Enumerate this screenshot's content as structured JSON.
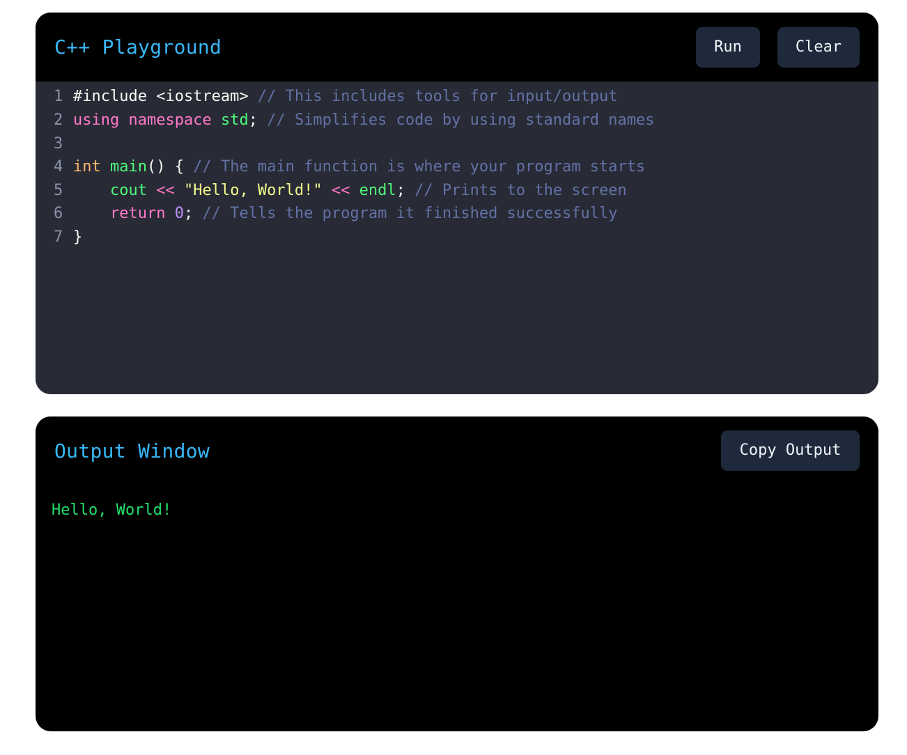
{
  "editor": {
    "title": "C++ Playground",
    "run_label": "Run",
    "clear_label": "Clear",
    "lines": [
      {
        "num": "1",
        "tokens": [
          {
            "text": "#include <iostream> ",
            "cls": "t-plain"
          },
          {
            "text": "// This includes tools for input/output",
            "cls": "t-comment"
          }
        ]
      },
      {
        "num": "2",
        "tokens": [
          {
            "text": "using",
            "cls": "t-kw"
          },
          {
            "text": " ",
            "cls": "t-plain"
          },
          {
            "text": "namespace",
            "cls": "t-kw"
          },
          {
            "text": " ",
            "cls": "t-plain"
          },
          {
            "text": "std",
            "cls": "t-fn"
          },
          {
            "text": "; ",
            "cls": "t-plain"
          },
          {
            "text": "// Simplifies code by using standard names",
            "cls": "t-comment"
          }
        ]
      },
      {
        "num": "3",
        "tokens": []
      },
      {
        "num": "4",
        "tokens": [
          {
            "text": "int",
            "cls": "t-type"
          },
          {
            "text": " ",
            "cls": "t-plain"
          },
          {
            "text": "main",
            "cls": "t-fn"
          },
          {
            "text": "() { ",
            "cls": "t-plain"
          },
          {
            "text": "// The main function is where your program starts",
            "cls": "t-comment"
          }
        ]
      },
      {
        "num": "5",
        "tokens": [
          {
            "text": "    ",
            "cls": "t-plain"
          },
          {
            "text": "cout",
            "cls": "t-fn"
          },
          {
            "text": " ",
            "cls": "t-plain"
          },
          {
            "text": "<<",
            "cls": "t-kw"
          },
          {
            "text": " ",
            "cls": "t-plain"
          },
          {
            "text": "\"Hello, World!\"",
            "cls": "t-str"
          },
          {
            "text": " ",
            "cls": "t-plain"
          },
          {
            "text": "<<",
            "cls": "t-kw"
          },
          {
            "text": " ",
            "cls": "t-plain"
          },
          {
            "text": "endl",
            "cls": "t-fn"
          },
          {
            "text": "; ",
            "cls": "t-plain"
          },
          {
            "text": "// Prints to the screen",
            "cls": "t-comment"
          }
        ]
      },
      {
        "num": "6",
        "tokens": [
          {
            "text": "    ",
            "cls": "t-plain"
          },
          {
            "text": "return",
            "cls": "t-kw"
          },
          {
            "text": " ",
            "cls": "t-plain"
          },
          {
            "text": "0",
            "cls": "t-num"
          },
          {
            "text": "; ",
            "cls": "t-plain"
          },
          {
            "text": "// Tells the program it finished successfully",
            "cls": "t-comment"
          }
        ]
      },
      {
        "num": "7",
        "tokens": [
          {
            "text": "}",
            "cls": "t-plain"
          }
        ]
      }
    ]
  },
  "output": {
    "title": "Output Window",
    "copy_label": "Copy Output",
    "text": "Hello, World!"
  },
  "colors": {
    "title": "#38b6f5",
    "button_bg": "#1e293b",
    "editor_bg": "#282a36",
    "output_text": "#22e06a"
  }
}
